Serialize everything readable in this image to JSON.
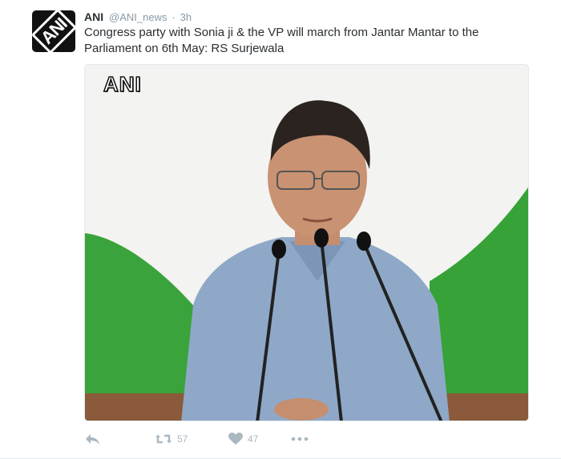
{
  "tweet": {
    "author": {
      "display_name": "ANI",
      "handle": "@ANI_news",
      "separator": "·",
      "time": "3h",
      "avatar_text": "ANI"
    },
    "text": "Congress party with Sonia ji & the VP will march from Jantar Mantar to the Parliament on 6th May: RS Surjewala",
    "media": {
      "watermark": "ANI"
    },
    "actions": {
      "reply_icon": "reply-arrow-icon",
      "retweet_icon": "retweet-icon",
      "retweet_count": "57",
      "like_icon": "heart-icon",
      "like_count": "47",
      "more_icon": "ellipsis-icon"
    }
  },
  "colors": {
    "text": "#292f33",
    "muted": "#8899a6",
    "action_icon": "#aab8c2",
    "background_green": "#39a23a"
  }
}
